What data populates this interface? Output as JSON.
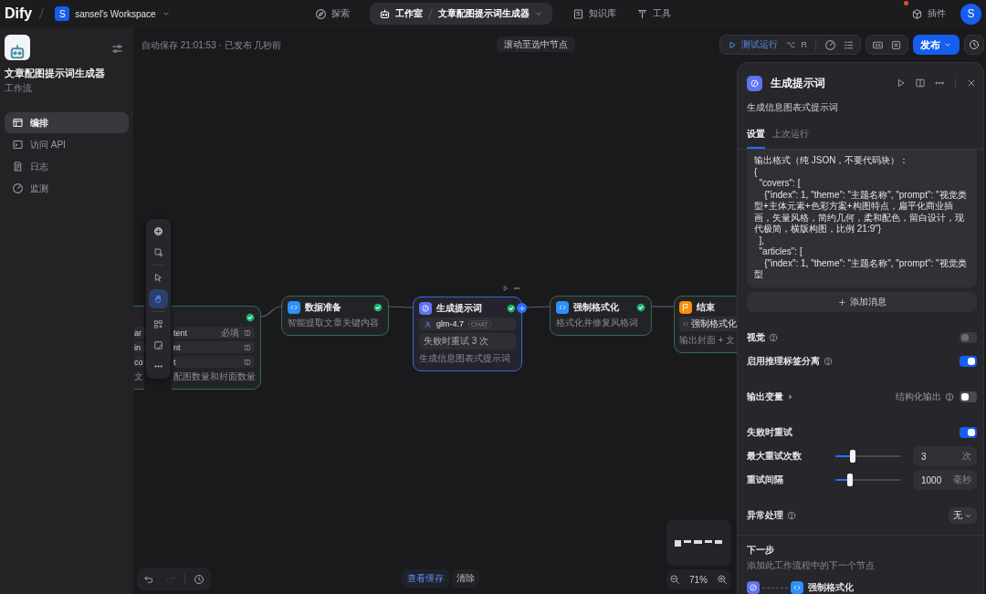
{
  "topbar": {
    "logo": "Dify",
    "workspace": {
      "initial": "S",
      "name": "sansel's Workspace"
    },
    "nav": [
      {
        "label": "探索",
        "selected": false
      },
      {
        "label": "工作室",
        "selected": true,
        "app": "文章配图提示词生成器"
      },
      {
        "label": "知识库",
        "selected": false
      },
      {
        "label": "工具",
        "selected": false
      }
    ],
    "plugins": {
      "label": "插件",
      "notification": true
    },
    "avatar": "S"
  },
  "sidebar": {
    "app_name": "文章配图提示词生成器",
    "app_type": "工作流",
    "items": [
      {
        "label": "编排",
        "selected": true
      },
      {
        "label": "访问 API",
        "selected": false
      },
      {
        "label": "日志",
        "selected": false
      },
      {
        "label": "监测",
        "selected": false
      }
    ]
  },
  "canvas": {
    "autosave": "自动保存 21:01:53 · 已发布 几秒前",
    "scroll_button": "滚动至选中节点",
    "tools": [
      {
        "kind": "add-block",
        "selected": false
      },
      {
        "kind": "add-note",
        "selected": false
      },
      {
        "kind": "pointer",
        "selected": false
      },
      {
        "kind": "hand",
        "selected": true
      },
      {
        "kind": "organize",
        "selected": false
      },
      {
        "kind": "minimap",
        "selected": false
      },
      {
        "kind": "more",
        "selected": false
      }
    ],
    "nodes": [
      {
        "kind": "start",
        "succeeded": true,
        "selected": false,
        "variables": [
          {
            "start": "ar",
            "end": "tent",
            "tag": "必填"
          },
          {
            "start": "in",
            "end": "nt"
          },
          {
            "start": "co",
            "end": "t"
          }
        ],
        "description_start": "文",
        "description_end": "配图数量和封面数量"
      },
      {
        "kind": "code",
        "title": "数据准备",
        "description": "智能提取文章关键内容",
        "succeeded": true,
        "selected": false
      },
      {
        "kind": "llm",
        "title": "生成提示词",
        "model": "glm-4.7",
        "mode": "CHAT",
        "retry": "失败时重试 3 次",
        "description": "生成信息图表式提示词",
        "succeeded": true,
        "selected": true
      },
      {
        "kind": "code",
        "title": "强制格式化",
        "description": "格式化并修复风格词",
        "succeeded": true,
        "selected": false
      },
      {
        "kind": "end",
        "title": "结束",
        "outputs": [
          "强制格式化"
        ],
        "description": "输出封面 + 文",
        "succeeded": false,
        "selected": false
      }
    ],
    "history": [
      {
        "kind": "undo",
        "disabled": false
      },
      {
        "kind": "redo",
        "disabled": true
      },
      {
        "kind": "versions",
        "disabled": false
      }
    ],
    "cache": {
      "view": "查看缓存",
      "clear": "清除"
    },
    "zoom": "71%"
  },
  "toolbar": {
    "test_run": "测试运行",
    "keys": [
      "⌥",
      "R"
    ],
    "publish": "发布"
  },
  "panel": {
    "title": "生成提示词",
    "description": "生成信息图表式提示词",
    "tabs": [
      {
        "label": "设置",
        "selected": true
      },
      {
        "label": "上次运行",
        "selected": false
      }
    ],
    "prompt": "输出格式（纯 JSON，不要代码块）：\n{\n  \"covers\": [\n    {\"index\": 1, \"theme\": \"主题名称\", \"prompt\": \"视觉类型+主体元素+色彩方案+构图特点，扁平化商业插画，矢量风格，简约几何，柔和配色，留白设计，现代极简，横版构图，比例 21:9\"}\n  ],\n  \"articles\": [\n    {\"index\": 1, \"theme\": \"主题名称\", \"prompt\": \"视觉类型",
    "add_message": "添加消息",
    "sections": [
      {
        "rows": [
          {
            "kind": "toggle",
            "label": "视觉",
            "help": true,
            "on": false,
            "disabled": true
          },
          {
            "kind": "toggle",
            "label": "启用推理标签分离",
            "help": true,
            "on": true,
            "disabled": false
          }
        ]
      },
      {
        "rows": [
          {
            "kind": "output",
            "label": "输出变量",
            "extra": "结构化输出",
            "on": false,
            "disabled": false
          }
        ]
      },
      {
        "rows": [
          {
            "kind": "toggle",
            "label": "失败时重试",
            "help": false,
            "on": true,
            "disabled": false
          },
          {
            "kind": "slider",
            "label": "最大重试次数",
            "level": 0.24,
            "value": "3",
            "unit": "次"
          },
          {
            "kind": "slider",
            "label": "重试间隔",
            "level": 0.2,
            "value": "1000",
            "unit": "毫秒"
          }
        ]
      },
      {
        "rows": [
          {
            "kind": "select",
            "label": "异常处理",
            "help": true,
            "value": "无"
          }
        ]
      }
    ],
    "next_step": {
      "title": "下一步",
      "hint": "添加此工作流程中的下一个节点",
      "node": "强制格式化"
    }
  }
}
